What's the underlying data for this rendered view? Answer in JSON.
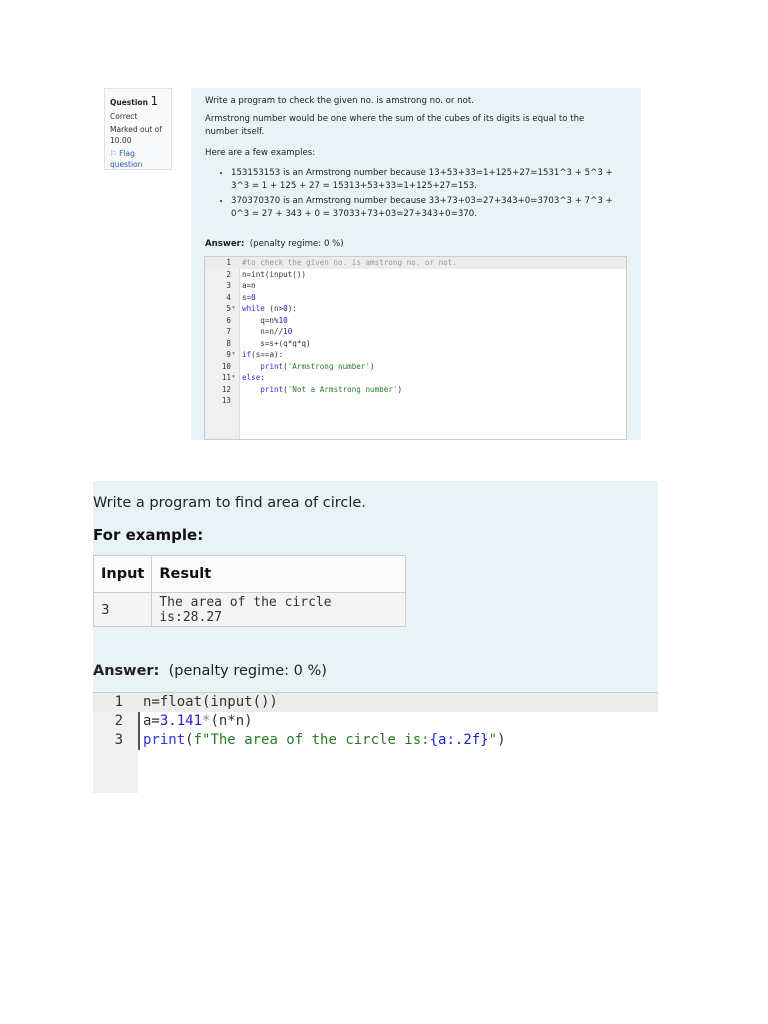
{
  "q1": {
    "info": {
      "label": "Question",
      "number": "1",
      "status": "Correct",
      "marked": "Marked out of",
      "mark_value": "10.00",
      "flag": "Flag question"
    },
    "prompt": "Write a program to check the given no. is amstrong no. or not.",
    "definition": "Armstrong number would be one where the sum of the cubes of its digits is equal to the number itself.",
    "examples_intro": "Here are a few examples:",
    "examples": [
      "153153153 is an Armstrong number because 13+53+33=1+125+27=1531^3 + 5^3 + 3^3 = 1 + 125 + 27 = 15313+53+33=1+125+27=153.",
      "370370370 is an Armstrong number because 33+73+03=27+343+0=3703^3 + 7^3 + 0^3 = 27 + 343 + 0 = 37033+73+03=27+343+0=370."
    ],
    "answer_label": "Answer:",
    "penalty": "(penalty regime: 0 %)",
    "code": [
      {
        "n": "1",
        "fold": false,
        "tokens": [
          [
            "#to check the given no. is amstrong no. or not.",
            "cm"
          ]
        ]
      },
      {
        "n": "2",
        "fold": false,
        "tokens": [
          [
            "n=int(input())",
            "tx"
          ]
        ]
      },
      {
        "n": "3",
        "fold": false,
        "tokens": [
          [
            "a=n",
            "tx"
          ]
        ]
      },
      {
        "n": "4",
        "fold": false,
        "tokens": [
          [
            "s=",
            "tx"
          ],
          [
            "0",
            "num"
          ]
        ]
      },
      {
        "n": "5",
        "fold": true,
        "tokens": [
          [
            "while",
            "kw"
          ],
          [
            " (n>",
            "tx"
          ],
          [
            "0",
            "num"
          ],
          [
            "):",
            "tx"
          ]
        ]
      },
      {
        "n": "6",
        "fold": false,
        "tokens": [
          [
            "    q=n%",
            "tx"
          ],
          [
            "10",
            "num"
          ]
        ]
      },
      {
        "n": "7",
        "fold": false,
        "tokens": [
          [
            "    n=n//",
            "tx"
          ],
          [
            "10",
            "num"
          ]
        ]
      },
      {
        "n": "8",
        "fold": false,
        "tokens": [
          [
            "    s=s+(q*q*q)",
            "tx"
          ]
        ]
      },
      {
        "n": "9",
        "fold": true,
        "tokens": [
          [
            "if",
            "kw"
          ],
          [
            "(s==a):",
            "tx"
          ]
        ]
      },
      {
        "n": "10",
        "fold": false,
        "tokens": [
          [
            "    ",
            "tx"
          ],
          [
            "print",
            "kw"
          ],
          [
            "(",
            "tx"
          ],
          [
            "'Armstrong number'",
            "str"
          ],
          [
            ")",
            "tx"
          ]
        ]
      },
      {
        "n": "11",
        "fold": true,
        "tokens": [
          [
            "else",
            "kw"
          ],
          [
            ":",
            "tx"
          ]
        ]
      },
      {
        "n": "12",
        "fold": false,
        "tokens": [
          [
            "    ",
            "tx"
          ],
          [
            "print",
            "kw"
          ],
          [
            "(",
            "tx"
          ],
          [
            "'Not a Armstrong number'",
            "str"
          ],
          [
            ")",
            "tx"
          ]
        ]
      },
      {
        "n": "13",
        "fold": false,
        "tokens": []
      }
    ]
  },
  "q2": {
    "prompt": "Write a program to find area of circle.",
    "for_example": "For example:",
    "table": {
      "headers": [
        "Input",
        "Result"
      ],
      "rows": [
        [
          "3",
          "The area of the circle is:28.27"
        ]
      ]
    },
    "answer_label": "Answer:",
    "penalty": "(penalty regime: 0 %)",
    "code": [
      {
        "n": "1",
        "tokens": [
          [
            "n=float(input())",
            "tx"
          ]
        ]
      },
      {
        "n": "2",
        "tokens": [
          [
            "a=",
            "tx"
          ],
          [
            "3.141",
            "num"
          ],
          [
            "*",
            "op"
          ],
          [
            "(n*n)",
            "tx"
          ]
        ]
      },
      {
        "n": "3",
        "tokens": [
          [
            "print",
            "kw"
          ],
          [
            "(",
            "tx"
          ],
          [
            "f\"The area of the circle is:",
            "str"
          ],
          [
            "{a:.2f}",
            "num"
          ],
          [
            "\"",
            "str"
          ],
          [
            ")",
            "tx"
          ]
        ]
      }
    ]
  }
}
